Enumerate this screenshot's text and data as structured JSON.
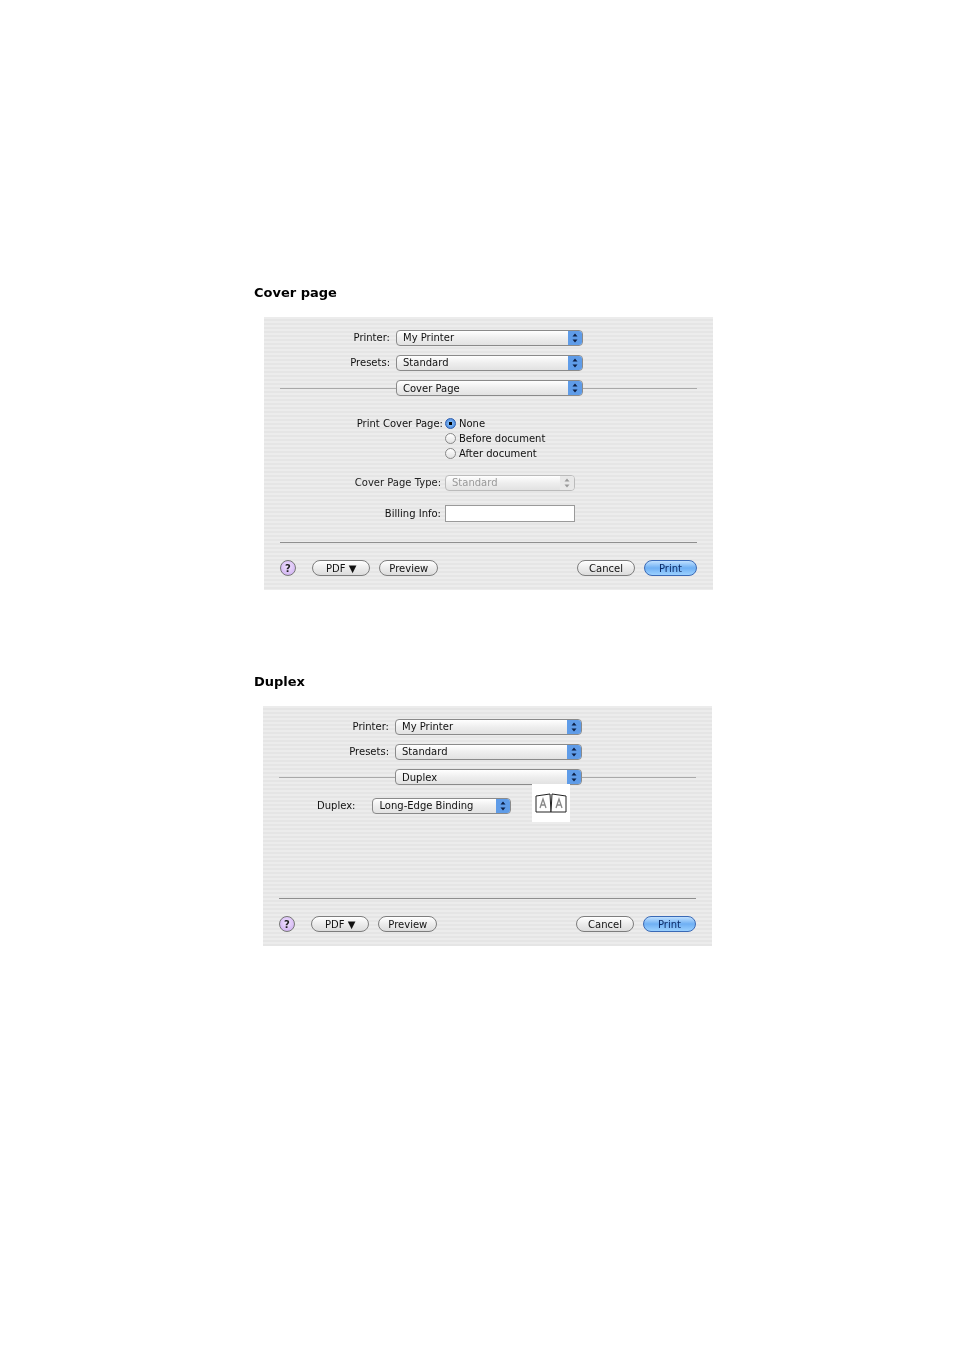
{
  "sections": [
    {
      "heading": "Cover page",
      "dialog": {
        "printer": {
          "label": "Printer:",
          "value": "My Printer"
        },
        "presets": {
          "label": "Presets:",
          "value": "Standard"
        },
        "panel_menu": "Cover Page",
        "panel": {
          "kind": "cover_page",
          "items": [
            {
              "kind": "radio_group",
              "label": "Print Cover Page:",
              "options": [
                {
                  "label": "None",
                  "selected": true
                },
                {
                  "label": "Before document",
                  "selected": false
                },
                {
                  "label": "After document",
                  "selected": false
                }
              ]
            },
            {
              "kind": "popup",
              "label": "Cover Page Type:",
              "value": "Standard",
              "disabled": true
            },
            {
              "kind": "text_field",
              "label": "Billing Info:"
            }
          ]
        },
        "help": "?",
        "buttons": [
          {
            "label": "PDF ▼",
            "default": false
          },
          {
            "label": "Preview",
            "default": false
          },
          {
            "label": "Cancel",
            "default": false
          },
          {
            "label": "Print",
            "default": true
          }
        ]
      }
    },
    {
      "heading": "Duplex",
      "dialog": {
        "printer": {
          "label": "Printer:",
          "value": "My Printer"
        },
        "presets": {
          "label": "Presets:",
          "value": "Standard"
        },
        "panel_menu": "Duplex",
        "panel": {
          "kind": "duplex",
          "items": [
            {
              "kind": "popup",
              "label": "Duplex:",
              "value": "Long-Edge Binding",
              "disabled": false
            },
            {
              "kind": "preview"
            }
          ]
        },
        "help": "?",
        "buttons": [
          {
            "label": "PDF ▼",
            "default": false
          },
          {
            "label": "Preview",
            "default": false
          },
          {
            "label": "Cancel",
            "default": false
          },
          {
            "label": "Print",
            "default": true
          }
        ]
      }
    }
  ]
}
